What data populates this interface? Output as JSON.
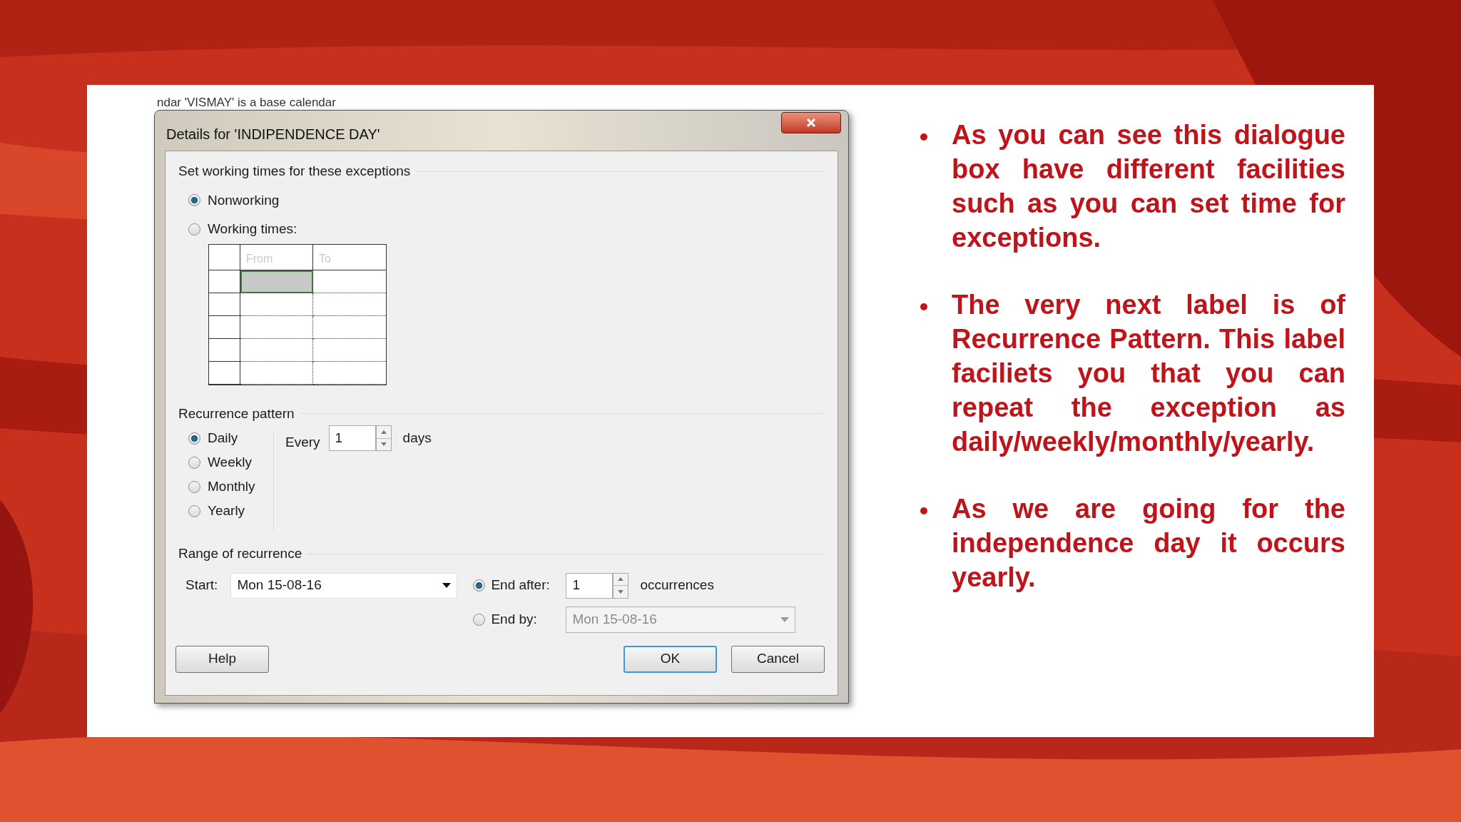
{
  "background_window": {
    "text": "ndar 'VISMAY' is a base calendar"
  },
  "dialog": {
    "title": "Details for 'INDIPENDENCE DAY'",
    "working_times": {
      "heading": "Set working times for these exceptions",
      "options": [
        {
          "label": "Nonworking",
          "selected": true
        },
        {
          "label": "Working times:",
          "selected": false
        }
      ],
      "grid_columns": [
        "From",
        "To"
      ]
    },
    "recurrence_pattern": {
      "heading": "Recurrence pattern",
      "options": [
        {
          "label": "Daily",
          "selected": true
        },
        {
          "label": "Weekly",
          "selected": false
        },
        {
          "label": "Monthly",
          "selected": false
        },
        {
          "label": "Yearly",
          "selected": false
        }
      ],
      "every_label": "Every",
      "every_value": "1",
      "unit": "days"
    },
    "range": {
      "heading": "Range of recurrence",
      "start_label": "Start:",
      "start_value": "Mon 15-08-16",
      "end_options": [
        {
          "kind": "spin",
          "label": "End after:",
          "selected": true,
          "value": "1",
          "unit": "occurrences",
          "disabled": false
        },
        {
          "kind": "date",
          "label": "End by:",
          "selected": false,
          "value": "Mon 15-08-16",
          "disabled": true
        }
      ]
    },
    "buttons": [
      {
        "label": "Help",
        "default": false
      },
      {
        "label": "OK",
        "default": true
      },
      {
        "label": "Cancel",
        "default": false
      }
    ]
  },
  "bullets": [
    "As you can see this dialogue box have different facilities such as you can set time for exceptions.",
    "The very next label is of Recurrence Pattern. This label faciliets you that you can repeat the exception as daily/weekly/monthly/yearly.",
    "As we are going for the independence day it occurs yearly."
  ]
}
